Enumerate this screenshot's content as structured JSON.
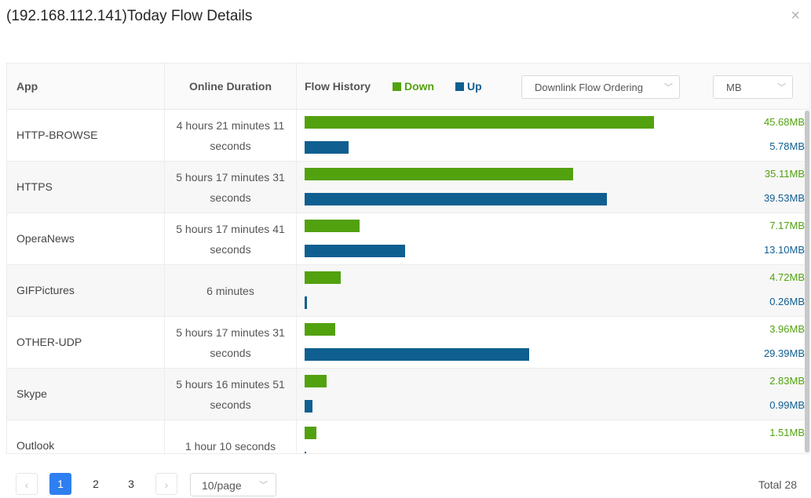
{
  "dialog": {
    "title": "(192.168.112.141)Today Flow Details",
    "close_icon": "×"
  },
  "table": {
    "headers": {
      "app": "App",
      "duration": "Online Duration",
      "history": "Flow History"
    },
    "legend": {
      "down": "Down",
      "up": "Up",
      "down_color": "#52a10f",
      "up_color": "#0f5f91"
    },
    "order_select": {
      "value": "Downlink Flow Ordering",
      "chevron": "﹀"
    },
    "unit_select": {
      "value": "MB",
      "chevron": "﹀"
    },
    "rows": [
      {
        "app": "HTTP-BROWSE",
        "duration": "4 hours 21 minutes 11 seconds",
        "down": "45.68MB",
        "up": "5.78MB",
        "down_mb": 45.68,
        "up_mb": 5.78
      },
      {
        "app": "HTTPS",
        "duration": "5 hours 17 minutes 31 seconds",
        "down": "35.11MB",
        "up": "39.53MB",
        "down_mb": 35.11,
        "up_mb": 39.53
      },
      {
        "app": "OperaNews",
        "duration": "5 hours 17 minutes 41 seconds",
        "down": "7.17MB",
        "up": "13.10MB",
        "down_mb": 7.17,
        "up_mb": 13.1
      },
      {
        "app": "GIFPictures",
        "duration": "6 minutes",
        "down": "4.72MB",
        "up": "0.26MB",
        "down_mb": 4.72,
        "up_mb": 0.26
      },
      {
        "app": "OTHER-UDP",
        "duration": "5 hours 17 minutes 31 seconds",
        "down": "3.96MB",
        "up": "29.39MB",
        "down_mb": 3.96,
        "up_mb": 29.39
      },
      {
        "app": "Skype",
        "duration": "5 hours 16 minutes 51 seconds",
        "down": "2.83MB",
        "up": "0.99MB",
        "down_mb": 2.83,
        "up_mb": 0.99
      },
      {
        "app": "Outlook",
        "duration": "1 hour 10 seconds",
        "down": "1.51MB",
        "up": "0.07MB",
        "down_mb": 1.51,
        "up_mb": 0.07
      }
    ]
  },
  "pagination": {
    "prev_icon": "‹",
    "next_icon": "›",
    "pages": [
      "1",
      "2",
      "3"
    ],
    "current_page": "1",
    "page_size": "10/page",
    "page_size_chevron": "﹀",
    "total": "Total 28"
  }
}
